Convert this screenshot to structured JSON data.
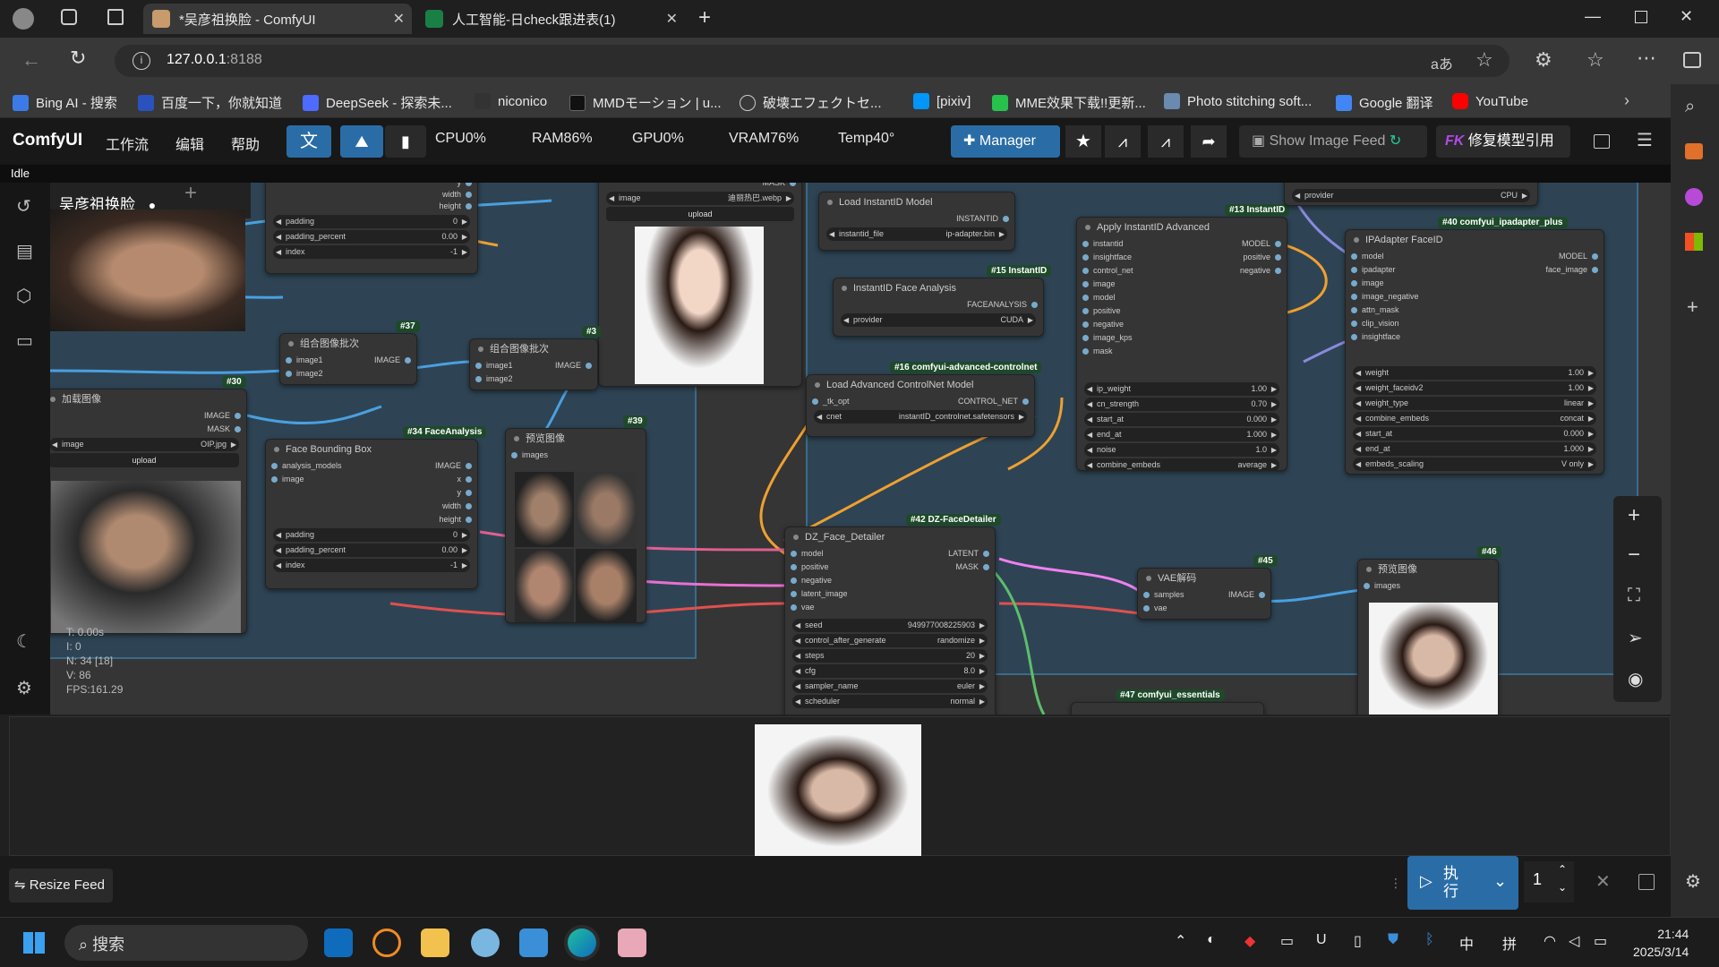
{
  "browser": {
    "tabs": [
      {
        "title": "*吴彦祖换脸 - ComfyUI",
        "active": true
      },
      {
        "title": "人工智能-日check跟进表(1)",
        "active": false
      }
    ],
    "url_host": "127.0.0.1",
    "url_port": ":8188",
    "bookmarks": [
      "Bing AI - 搜索",
      "百度一下，你就知道",
      "DeepSeek - 探索未...",
      "niconico",
      "MMDモーション | u...",
      "破壊エフェクトセ...",
      "[pixiv]",
      "MME效果下载!!更新...",
      "Photo stitching soft...",
      "Google 翻译",
      "YouTube"
    ]
  },
  "menu": {
    "logo": "ComfyUI",
    "items": [
      "工作流",
      "编辑",
      "帮助"
    ],
    "stats": {
      "cpu": "CPU0%",
      "ram": "RAM86%",
      "gpu": "GPU0%",
      "vram": "VRAM76%",
      "temp": "Temp40°"
    },
    "manager": "Manager",
    "show_feed": "Show Image Feed",
    "fk_label": "修复模型引用",
    "status": "Idle"
  },
  "workflow": {
    "tab_name": "吴彦祖换脸"
  },
  "nodes": {
    "load_instantid": {
      "title": "Load InstantID Model",
      "out": "INSTANTID",
      "w_label": "instantid_file",
      "w_value": "ip-adapter.bin"
    },
    "face_analysis": {
      "title": "InstantID Face Analysis",
      "tag": "#15 InstantID",
      "out": "FACEANALYSIS",
      "w_label": "provider",
      "w_value": "CUDA"
    },
    "controlnet": {
      "title": "Load Advanced ControlNet Model",
      "tag": "#16 comfyui-advanced-controlnet",
      "in": "_tk_opt",
      "out": "CONTROL_NET",
      "w_label": "cnet",
      "w_value": "instantID_controlnet.safetensors"
    },
    "apply_instantid": {
      "title": "Apply InstantID Advanced",
      "tag": "#13 InstantID",
      "inputs": [
        "instantid",
        "insightface",
        "control_net",
        "image",
        "model",
        "positive",
        "negative",
        "image_kps",
        "mask"
      ],
      "outputs": [
        "MODEL",
        "positive",
        "negative"
      ],
      "widgets": [
        [
          "ip_weight",
          "1.00"
        ],
        [
          "cn_strength",
          "0.70"
        ],
        [
          "start_at",
          "0.000"
        ],
        [
          "end_at",
          "1.000"
        ],
        [
          "noise",
          "1.0"
        ],
        [
          "combine_embeds",
          "average"
        ]
      ]
    },
    "ipadapter_faceid": {
      "title": "IPAdapter FaceID",
      "tag": "#40 comfyui_ipadapter_plus",
      "inputs": [
        "model",
        "ipadapter",
        "image",
        "image_negative",
        "attn_mask",
        "clip_vision",
        "insightface"
      ],
      "outputs": [
        "MODEL",
        "face_image"
      ],
      "widgets": [
        [
          "weight",
          "1.00"
        ],
        [
          "weight_faceidv2",
          "1.00"
        ],
        [
          "weight_type",
          "linear"
        ],
        [
          "combine_embeds",
          "concat"
        ],
        [
          "start_at",
          "0.000"
        ],
        [
          "end_at",
          "1.000"
        ],
        [
          "embeds_scaling",
          "V only"
        ]
      ]
    },
    "top_provider": {
      "w_label": "provider",
      "w_value": "CPU"
    },
    "top_left_node": {
      "outs": [
        "y",
        "width",
        "height"
      ],
      "widgets": [
        [
          "padding",
          "0"
        ],
        [
          "padding_percent",
          "0.00"
        ],
        [
          "index",
          "-1"
        ]
      ]
    },
    "load_image_top": {
      "out": "MASK",
      "w_label": "image",
      "w_value": "迪丽热巴.webp",
      "btn": "upload"
    },
    "batch1": {
      "title": "组合图像批次",
      "tag": "#37",
      "in1": "image1",
      "in2": "image2",
      "out": "IMAGE"
    },
    "batch2": {
      "title": "组合图像批次",
      "tag": "#3",
      "in1": "image1",
      "in2": "image2",
      "out": "IMAGE"
    },
    "load_image": {
      "title": "加载图像",
      "tag": "#30",
      "out1": "IMAGE",
      "out2": "MASK",
      "w_label": "image",
      "w_value": "OIP.jpg",
      "btn": "upload"
    },
    "face_bbox": {
      "title": "Face Bounding Box",
      "tag": "#34 FaceAnalysis",
      "in1": "analysis_models",
      "in2": "image",
      "outs": [
        "IMAGE",
        "x",
        "y",
        "width",
        "height"
      ],
      "widgets": [
        [
          "padding",
          "0"
        ],
        [
          "padding_percent",
          "0.00"
        ],
        [
          "index",
          "-1"
        ]
      ]
    },
    "preview39": {
      "title": "预览图像",
      "tag": "#39",
      "in": "images"
    },
    "face_detailer": {
      "title": "DZ_Face_Detailer",
      "tag": "#42 DZ-FaceDetailer",
      "inputs": [
        "model",
        "positive",
        "negative",
        "latent_image",
        "vae"
      ],
      "outputs": [
        "LATENT",
        "MASK"
      ],
      "widgets": [
        [
          "seed",
          "949977008225903"
        ],
        [
          "control_after_generate",
          "randomize"
        ],
        [
          "steps",
          "20"
        ],
        [
          "cfg",
          "8.0"
        ],
        [
          "sampler_name",
          "euler"
        ],
        [
          "scheduler",
          "normal"
        ]
      ]
    },
    "vae_decode": {
      "title": "VAE解码",
      "tag": "#45",
      "in1": "samples",
      "in2": "vae",
      "out": "IMAGE"
    },
    "preview46": {
      "title": "预览图像",
      "tag": "#46",
      "in": "images"
    },
    "essentials": {
      "tag": "#47 comfyui_essentials"
    }
  },
  "canvas_info": {
    "t": "T: 0.00s",
    "i": "I: 0",
    "n": "N: 34 [18]",
    "v": "V: 86",
    "fps": "FPS:161.29"
  },
  "queue": {
    "run_label": "执行",
    "batch_count": "1"
  },
  "resize_feed": "Resize Feed",
  "taskbar": {
    "search": "搜索",
    "time": "21:44",
    "date": "2025/3/14",
    "ime1": "中",
    "ime2": "拼"
  },
  "colors": {
    "accent": "#2a6da6",
    "canvas": "#353535",
    "group": "#2b5a7a"
  }
}
